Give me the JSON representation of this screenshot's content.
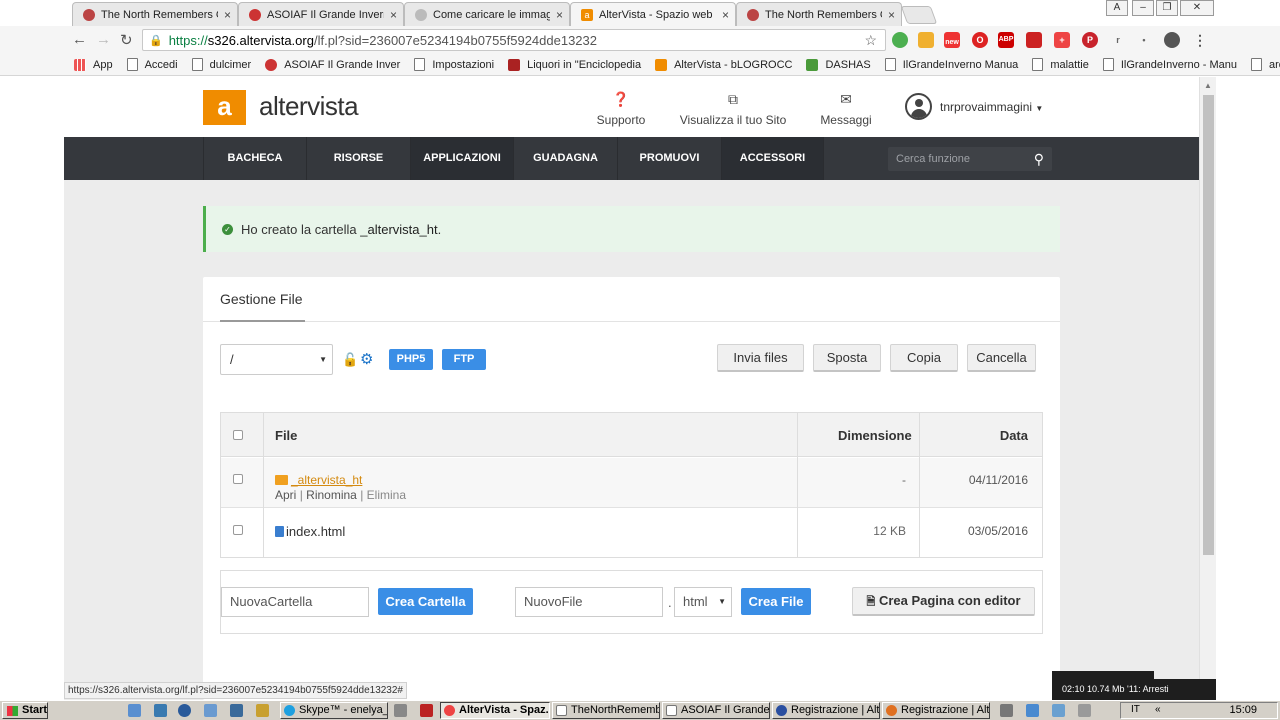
{
  "browser": {
    "tabs": [
      {
        "title": "The North Remembers GDF",
        "favicon_color": "#b44"
      },
      {
        "title": "ASOIAF Il Grande Inverno",
        "favicon_color": "#c33"
      },
      {
        "title": "Come caricare le immagini",
        "favicon_color": "#bbb"
      },
      {
        "title": "AlterVista - Spazio web gra",
        "favicon_color": "#f08c00"
      },
      {
        "title": "The North Remembers GDF",
        "favicon_color": "#b44"
      }
    ],
    "tab_close": "×",
    "url": {
      "scheme": "https://",
      "host": "s326.altervista.org",
      "path": "/lf.pl?sid=236007e5234194b0755f5924dde13232"
    },
    "bookmarks": [
      {
        "label": "App",
        "icon": "apps-grid-icon"
      },
      {
        "label": "Accedi",
        "icon": "page-icon"
      },
      {
        "label": "dulcimer",
        "icon": "page-icon"
      },
      {
        "label": "ASOIAF Il Grande Inver",
        "icon": "asoiaf-icon"
      },
      {
        "label": "Impostazioni",
        "icon": "page-icon"
      },
      {
        "label": "Liquori in \"Enciclopedia",
        "icon": "liquori-icon"
      },
      {
        "label": "AlterVista - bLOGROCC",
        "icon": "altervista-icon"
      },
      {
        "label": "DASHAS",
        "icon": "dashas-icon"
      },
      {
        "label": "IlGrandeInverno Manua",
        "icon": "page-icon"
      },
      {
        "label": "malattie",
        "icon": "page-icon"
      },
      {
        "label": "IlGrandeInverno - Manu",
        "icon": "page-icon"
      },
      {
        "label": "aromatica",
        "icon": "page-icon"
      }
    ],
    "bookmarks_overflow": "»",
    "ext_new_badge": "new",
    "status_url": "https://s326.altervista.org/lf.pl?sid=236007e5234194b0755f5924dde13232#"
  },
  "site": {
    "logo_letter": "a",
    "logo_text": "altervista",
    "header_links": [
      {
        "label": "Supporto",
        "icon": "help-circle-icon"
      },
      {
        "label": "Visualizza il tuo Sito",
        "icon": "external-link-icon"
      },
      {
        "label": "Messaggi",
        "icon": "envelope-icon"
      }
    ],
    "username": "tnrprovaimmagini",
    "nav": [
      "BACHECA",
      "RISORSE",
      "APPLICAZIONI",
      "GUADAGNA",
      "PROMUOVI",
      "ACCESSORI"
    ],
    "nav_active": "APPLICAZIONI",
    "search_placeholder": "Cerca funzione"
  },
  "alert": {
    "prefix": "Ho creato la cartella ",
    "folder": "_altervista_ht",
    "suffix": "."
  },
  "file_manager": {
    "title": "Gestione File",
    "current_dir": "/",
    "tags": [
      "PHP5",
      "FTP"
    ],
    "buttons": [
      "Invia files",
      "Sposta",
      "Copia",
      "Cancella"
    ],
    "columns": {
      "file": "File",
      "size": "Dimensione",
      "date": "Data"
    },
    "rows": [
      {
        "name": "_altervista_ht",
        "type": "folder",
        "size": "-",
        "date": "04/11/2016",
        "actions": [
          "Apri",
          "Rinomina",
          "Elimina"
        ]
      },
      {
        "name": "index.html",
        "type": "file",
        "size": "12 KB",
        "date": "03/05/2016"
      }
    ],
    "create": {
      "folder_placeholder": "NuovaCartella",
      "folder_button": "Crea Cartella",
      "file_placeholder": "NuovoFile",
      "ext_separator": ".",
      "ext_value": "html",
      "file_button": "Crea File",
      "editor_button": "Crea Pagina con editor"
    }
  },
  "overlay": {
    "text": "02:10  10.74 Mb  '11: Arresti"
  },
  "taskbar": {
    "start": "Start",
    "tasks": [
      {
        "label": "Skype™ - enelya_iaf",
        "color": "#1ea0e0"
      },
      {
        "label": "AlterVista - Spaz...",
        "color": "#e44",
        "active": true
      },
      {
        "label": "TheNorthRememb...",
        "color": "#fff"
      },
      {
        "label": "ASOIAF Il Grande I...",
        "color": "#fff"
      },
      {
        "label": "Registrazione | Alte...",
        "color": "#2a4fa0"
      },
      {
        "label": "Registrazione | Alte...",
        "color": "#e07020"
      }
    ],
    "lang": "IT",
    "clock": "15:09"
  }
}
